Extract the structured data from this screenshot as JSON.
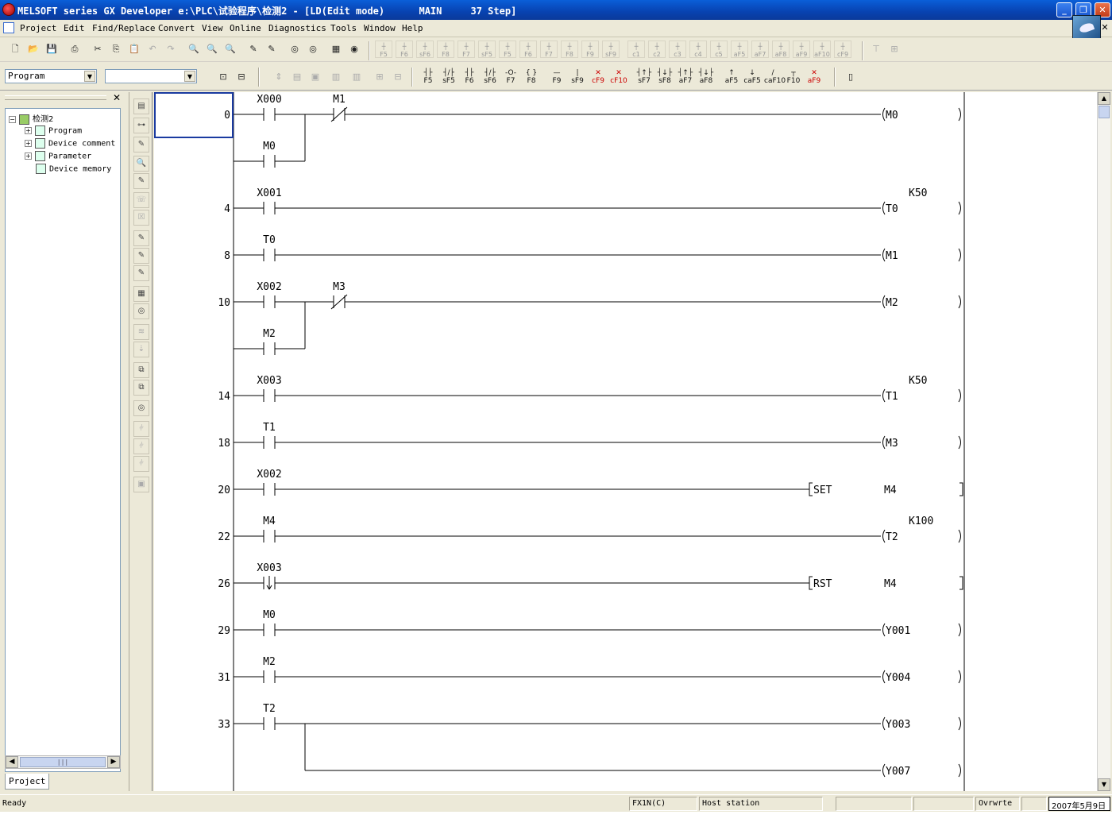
{
  "title": "MELSOFT series GX Developer e:\\PLC\\试验程序\\检测2 - [LD(Edit mode)      MAIN     37 Step]",
  "menu": [
    "Project",
    "Edit",
    "Find/Replace",
    "Convert",
    "View",
    "Online",
    "Diagnostics",
    "Tools",
    "Window",
    "Help"
  ],
  "toolbar2": {
    "program_combo": "Program",
    "second_combo": ""
  },
  "fkeys_top": [
    "F5",
    "F6",
    "sF6",
    "F8",
    "F7",
    "sF5",
    "F5",
    "F6",
    "F7",
    "F8",
    "F9",
    "sF9",
    "c1",
    "c2",
    "c3",
    "c4",
    "c5",
    "aF5",
    "aF7",
    "aF8",
    "aF9",
    "aF10",
    "cF9"
  ],
  "fkeys_ladder": [
    "F5",
    "sF5",
    "F6",
    "sF6",
    "F7",
    "F8",
    "F9",
    "sF9",
    "cF9",
    "cF10",
    "sF7",
    "sF8",
    "aF7",
    "aF8",
    "aF5",
    "caF5",
    "caF10",
    "F10",
    "aF9"
  ],
  "tree": {
    "root": "检测2",
    "items": [
      "Program",
      "Device comment",
      "Parameter",
      "Device memory"
    ],
    "tab": "Project"
  },
  "ladder": {
    "rungs": [
      {
        "step": "0",
        "contacts": [
          {
            "label": "X000",
            "type": "no"
          },
          {
            "label": "M1",
            "type": "nc"
          }
        ],
        "branch": {
          "label": "M0",
          "type": "no"
        },
        "coil": "M0",
        "kind": "coil"
      },
      {
        "step": "4",
        "contacts": [
          {
            "label": "X001",
            "type": "no"
          }
        ],
        "coil": "T0",
        "kind": "coil",
        "const": "K50"
      },
      {
        "step": "8",
        "contacts": [
          {
            "label": "T0",
            "type": "no"
          }
        ],
        "coil": "M1",
        "kind": "coil"
      },
      {
        "step": "10",
        "contacts": [
          {
            "label": "X002",
            "type": "no"
          },
          {
            "label": "M3",
            "type": "nc"
          }
        ],
        "branch": {
          "label": "M2",
          "type": "no"
        },
        "coil": "M2",
        "kind": "coil"
      },
      {
        "step": "14",
        "contacts": [
          {
            "label": "X003",
            "type": "no"
          }
        ],
        "coil": "T1",
        "kind": "coil",
        "const": "K50"
      },
      {
        "step": "18",
        "contacts": [
          {
            "label": "T1",
            "type": "no"
          }
        ],
        "coil": "M3",
        "kind": "coil"
      },
      {
        "step": "20",
        "contacts": [
          {
            "label": "X002",
            "type": "no"
          }
        ],
        "instr": "SET",
        "operand": "M4",
        "kind": "instr"
      },
      {
        "step": "22",
        "contacts": [
          {
            "label": "M4",
            "type": "no"
          }
        ],
        "coil": "T2",
        "kind": "coil",
        "const": "K100"
      },
      {
        "step": "26",
        "contacts": [
          {
            "label": "X003",
            "type": "fall"
          }
        ],
        "instr": "RST",
        "operand": "M4",
        "kind": "instr"
      },
      {
        "step": "29",
        "contacts": [
          {
            "label": "M0",
            "type": "no"
          }
        ],
        "coil": "Y001",
        "kind": "coil"
      },
      {
        "step": "31",
        "contacts": [
          {
            "label": "M2",
            "type": "no"
          }
        ],
        "coil": "Y004",
        "kind": "coil"
      },
      {
        "step": "33",
        "contacts": [
          {
            "label": "T2",
            "type": "no"
          }
        ],
        "coil": "Y003",
        "kind": "coil",
        "parallel_coil": "Y007"
      }
    ]
  },
  "status": {
    "ready": "Ready",
    "plc": "FX1N(C)",
    "station": "Host station",
    "mode": "Ovrwrte",
    "date": "2007年5月9日"
  },
  "colors": {
    "titlebar": "#0842b0",
    "bg": "#ece9d8"
  }
}
